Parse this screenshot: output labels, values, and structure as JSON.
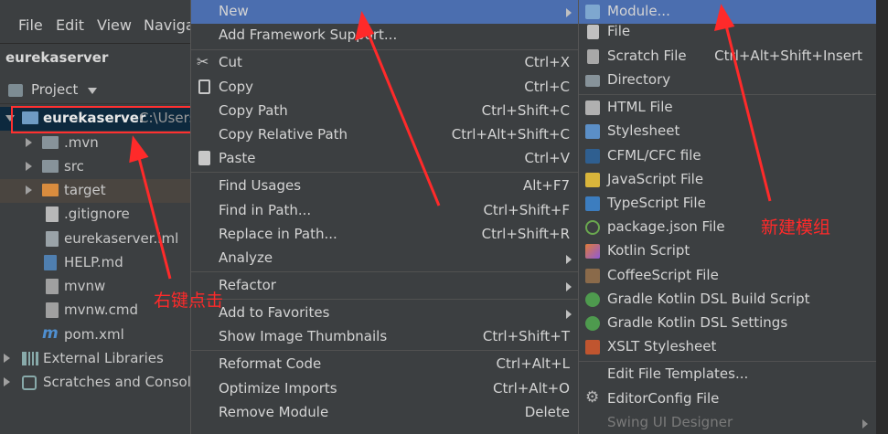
{
  "menubar": {
    "file": "File",
    "edit": "Edit",
    "view": "View",
    "navigate": "Naviga"
  },
  "project": {
    "name": "eurekaserver",
    "view_label": "Project",
    "root": "eurekaserver",
    "root_path": "C:\\Users"
  },
  "tree": [
    ".mvn",
    "src",
    "target",
    ".gitignore",
    "eurekaserver.iml",
    "HELP.md",
    "mvnw",
    "mvnw.cmd",
    "pom.xml",
    "External Libraries",
    "Scratches and Console"
  ],
  "context_menu": {
    "new": "New",
    "add_framework": "Add Framework Support...",
    "cut": "Cut",
    "cut_sc": "Ctrl+X",
    "copy": "Copy",
    "copy_sc": "Ctrl+C",
    "copy_path": "Copy Path",
    "copy_path_sc": "Ctrl+Shift+C",
    "copy_rel": "Copy Relative Path",
    "copy_rel_sc": "Ctrl+Alt+Shift+C",
    "paste": "Paste",
    "paste_sc": "Ctrl+V",
    "find_usages": "Find Usages",
    "find_usages_sc": "Alt+F7",
    "find_path": "Find in Path...",
    "find_path_sc": "Ctrl+Shift+F",
    "replace_path": "Replace in Path...",
    "replace_path_sc": "Ctrl+Shift+R",
    "analyze": "Analyze",
    "refactor": "Refactor",
    "add_fav": "Add to Favorites",
    "thumbs": "Show Image Thumbnails",
    "thumbs_sc": "Ctrl+Shift+T",
    "reformat": "Reformat Code",
    "reformat_sc": "Ctrl+Alt+L",
    "optimize": "Optimize Imports",
    "optimize_sc": "Ctrl+Alt+O",
    "remove_module": "Remove Module",
    "remove_module_sc": "Delete"
  },
  "new_menu": {
    "module": "Module...",
    "file": "File",
    "scratch": "Scratch File",
    "scratch_sc": "Ctrl+Alt+Shift+Insert",
    "directory": "Directory",
    "html": "HTML File",
    "stylesheet": "Stylesheet",
    "cfml": "CFML/CFC file",
    "js": "JavaScript File",
    "ts": "TypeScript File",
    "pkgjson": "package.json File",
    "kotlin": "Kotlin Script",
    "coffee": "CoffeeScript File",
    "gradle_build": "Gradle Kotlin DSL Build Script",
    "gradle_settings": "Gradle Kotlin DSL Settings",
    "xslt": "XSLT Stylesheet",
    "edit_templates": "Edit File Templates...",
    "editorconfig": "EditorConfig File",
    "swing": "Swing UI Designer"
  },
  "annotations": {
    "right_click": "右键点击",
    "new_module": "新建模组"
  },
  "colors": {
    "highlight": "#4b6eaf",
    "annotation": "#ff2a2a",
    "bg": "#3c3f41"
  }
}
